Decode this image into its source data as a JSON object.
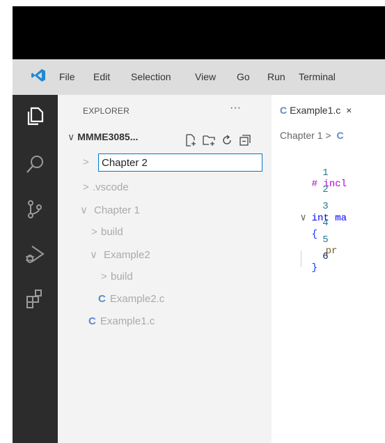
{
  "menubar": {
    "items": [
      "File",
      "Edit",
      "Selection",
      "View",
      "Go",
      "Run",
      "Terminal"
    ]
  },
  "activity_icons": [
    "explorer-icon",
    "search-icon",
    "source-control-icon",
    "run-debug-icon",
    "extensions-icon"
  ],
  "explorer": {
    "title": "EXPLORER",
    "more": "···",
    "folder_name": "MMME3085...",
    "rename_value": "Chapter 2",
    "tree": [
      {
        "chevron": ">",
        "label": ".vscode",
        "kind": "folder"
      },
      {
        "chevron": "∨",
        "label": "Chapter 1",
        "kind": "folder"
      },
      {
        "chevron": ">",
        "label": "build",
        "kind": "folder"
      },
      {
        "chevron": "∨",
        "label": "Example2",
        "kind": "folder"
      },
      {
        "chevron": ">",
        "label": "build",
        "kind": "folder"
      },
      {
        "chevron": "C",
        "label": "Example2.c",
        "kind": "file"
      },
      {
        "chevron": "C",
        "label": "Example1.c",
        "kind": "file"
      }
    ]
  },
  "editor": {
    "tab_icon": "C",
    "tab_label": "Example1.c",
    "tab_close": "×",
    "breadcrumb": "Chapter 1 >",
    "breadcrumb_icon": "C",
    "lines": [
      {
        "n": "1",
        "fold": "",
        "text": "# incl"
      },
      {
        "n": "2",
        "fold": "",
        "text": ""
      },
      {
        "n": "3",
        "fold": "∨",
        "text": "int ma"
      },
      {
        "n": "4",
        "fold": "",
        "text": "{"
      },
      {
        "n": "5",
        "fold": "",
        "text": "pr"
      },
      {
        "n": "6",
        "fold": "",
        "text": "}"
      }
    ]
  },
  "colors": {
    "accent": "#007acc",
    "activity_bg": "#2c2c2c",
    "sidebar_bg": "#f3f3f3",
    "menubar_bg": "#dddddd",
    "keyword": "#0000ff",
    "preproc": "#af00db",
    "c_file": "#5b8ac7"
  }
}
